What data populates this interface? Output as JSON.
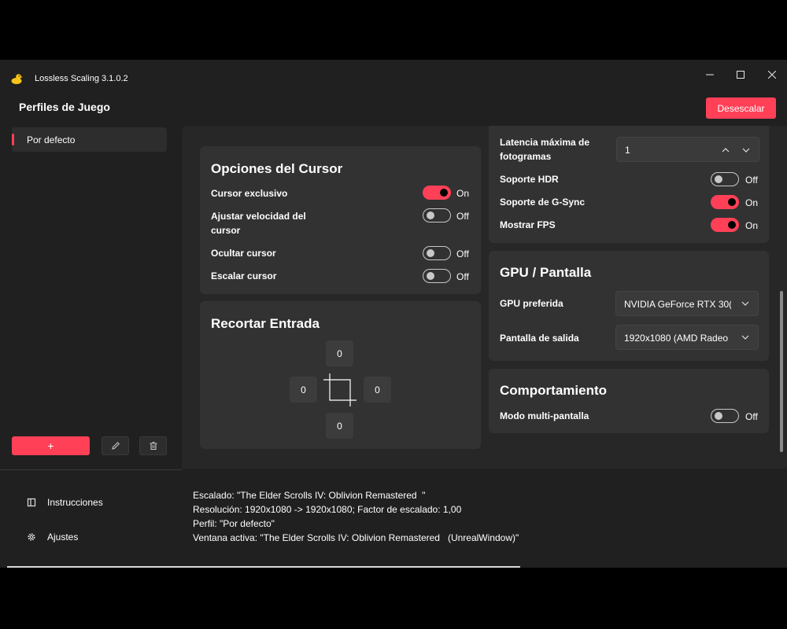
{
  "window": {
    "title": "Lossless Scaling 3.1.0.2"
  },
  "header": {
    "title": "Perfiles de Juego",
    "unscale_label": "Desescalar"
  },
  "sidebar": {
    "profiles": [
      {
        "label": "Por defecto"
      }
    ],
    "add_label": "+",
    "nav": [
      {
        "label": "Instrucciones",
        "icon": "book-icon"
      },
      {
        "label": "Ajustes",
        "icon": "gear-icon"
      }
    ]
  },
  "cursor_options": {
    "title": "Opciones del Cursor",
    "rows": [
      {
        "label": "Cursor exclusivo",
        "state": "On"
      },
      {
        "label": "Ajustar velocidad del cursor",
        "state": "Off"
      },
      {
        "label": "Ocultar cursor",
        "state": "Off"
      },
      {
        "label": "Escalar cursor",
        "state": "Off"
      }
    ]
  },
  "crop_input": {
    "title": "Recortar Entrada",
    "top": "0",
    "left": "0",
    "right": "0",
    "bottom": "0"
  },
  "frame_options": {
    "latency_label": "Latencia máxima de fotogramas",
    "latency_value": "1",
    "rows": [
      {
        "label": "Soporte HDR",
        "state": "Off"
      },
      {
        "label": "Soporte de G-Sync",
        "state": "On"
      },
      {
        "label": "Mostrar FPS",
        "state": "On"
      }
    ]
  },
  "gpu_display": {
    "title": "GPU / Pantalla",
    "gpu_label": "GPU preferida",
    "gpu_value": "NVIDIA GeForce RTX 30(",
    "display_label": "Pantalla de salida",
    "display_value": "1920x1080 (AMD Radeo"
  },
  "behavior": {
    "title": "Comportamiento",
    "multi_label": "Modo multi-pantalla",
    "multi_state": "Off"
  },
  "status": {
    "line1": "Escalado: \"The Elder Scrolls IV: Oblivion Remastered  \"",
    "line2": "Resolución: 1920x1080 -> 1920x1080; Factor de escalado: 1,00",
    "line3": "Perfil: \"Por defecto\"",
    "line4": "Ventana activa: \"The Elder Scrolls IV: Oblivion Remastered   (UnrealWindow)\""
  },
  "colors": {
    "accent": "#ff4057",
    "background": "#202020",
    "card": "#323232"
  }
}
